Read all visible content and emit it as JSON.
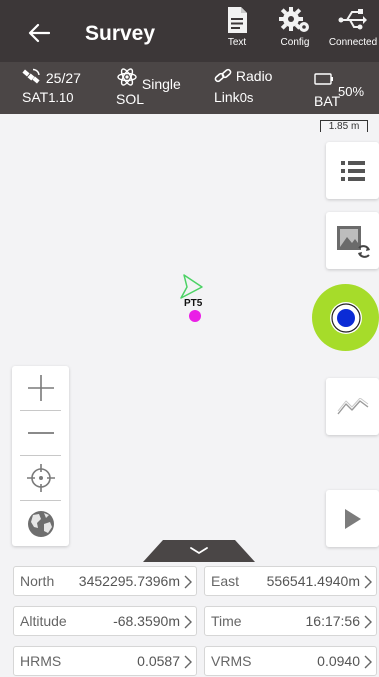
{
  "header": {
    "title": "Survey",
    "tools": [
      {
        "label": "Text",
        "icon": "text-document-icon"
      },
      {
        "label": "Config",
        "icon": "gear-icon"
      },
      {
        "label": "Connected",
        "icon": "usb-icon"
      }
    ]
  },
  "status": {
    "satellites": "25/27",
    "sat_label": "SAT",
    "sat_value": "1.10",
    "solution": "Single",
    "sol_label": "SOL",
    "radio": "Radio",
    "link_label": "Link",
    "link_value": "0s",
    "battery": "50%",
    "bat_label": "BAT"
  },
  "map": {
    "scale": "1.85 m",
    "point_label": "PT5",
    "point_color": "#ea1fe6",
    "cursor_color": "#4cd265",
    "locate_outer_color": "#a6dc2a",
    "locate_inner_color": "#0b2bd6"
  },
  "fields": [
    {
      "key": "North",
      "value": "3452295.7396m"
    },
    {
      "key": "East",
      "value": "556541.4940m"
    },
    {
      "key": "Altitude",
      "value": "-68.3590m"
    },
    {
      "key": "Time",
      "value": "16:17:56"
    },
    {
      "key": "HRMS",
      "value": "0.0587"
    },
    {
      "key": "VRMS",
      "value": "0.0940"
    }
  ]
}
